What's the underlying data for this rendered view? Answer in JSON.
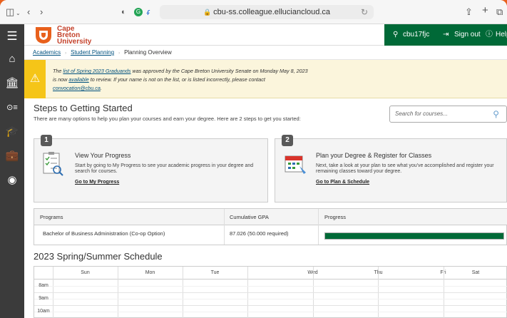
{
  "browser": {
    "url": "cbu-ss.colleague.elluciancloud.ca"
  },
  "header": {
    "logo_text": [
      "Cape",
      "Breton",
      "University"
    ],
    "user": "cbu17fjc",
    "sign_out": "Sign out",
    "help": "Help"
  },
  "breadcrumb": {
    "items": [
      "Academics",
      "Student Planning",
      "Planning Overview"
    ]
  },
  "alert": {
    "part1": "The ",
    "link1": "list of Spring 2023 Graduands",
    "part2": " was approved by the Cape Breton University Senate on Monday May 8, 2023 is now ",
    "link2": "available",
    "part3": " to review. If your name is not on the list, or is listed incorrectly, please contact ",
    "link3": "convocation@cbu.ca",
    "part4": "."
  },
  "steps": {
    "title": "Steps to Getting Started",
    "subtitle": "There are many options to help you plan your courses and earn your degree. Here are 2 steps to get you started:",
    "search_placeholder": "Search for courses...",
    "cards": [
      {
        "number": "1",
        "title": "View Your Progress",
        "desc": "Start by going to My Progress to see your academic progress in your degree and search for courses.",
        "link": "Go to My Progress"
      },
      {
        "number": "2",
        "title": "Plan your Degree & Register for Classes",
        "desc": "Next, take a look at your plan to see what you've accomplished and register your remaining classes toward your degree.",
        "link": "Go to Plan & Schedule"
      }
    ]
  },
  "programs": {
    "headers": [
      "Programs",
      "Cumulative GPA",
      "Progress"
    ],
    "rows": [
      {
        "program": "Bachelor of Business Administration (Co-op Option)",
        "gpa": "87.026 (50.000 required)",
        "progress": 1.0
      }
    ]
  },
  "schedule": {
    "title": "2023 Spring/Summer Schedule",
    "days": [
      "Sun",
      "Mon",
      "Tue",
      "Wed",
      "Thu",
      "Fri",
      "Sat"
    ],
    "hours": [
      "8am",
      "9am",
      "10am"
    ]
  },
  "colors": {
    "brand_orange": "#e8601c",
    "green": "#006937",
    "alert_yellow": "#f5c518"
  }
}
